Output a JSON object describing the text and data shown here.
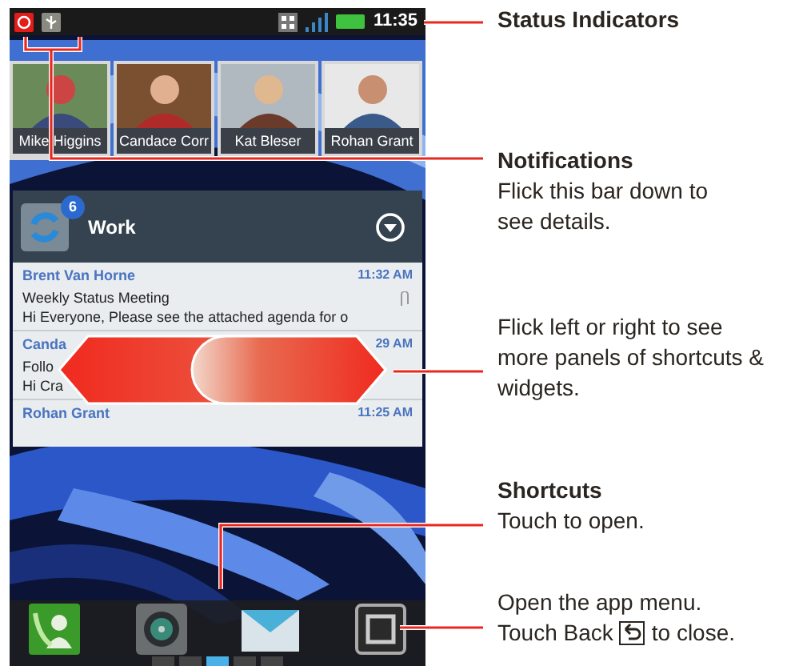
{
  "status_bar": {
    "notification_icons": [
      {
        "kind": "email"
      },
      {
        "kind": "usb"
      }
    ],
    "time": "11:35"
  },
  "contacts": [
    {
      "name": "Mike Higgins"
    },
    {
      "name": "Candace Corr"
    },
    {
      "name": "Kat Bleser"
    },
    {
      "name": "Rohan Grant"
    }
  ],
  "widget": {
    "title": "Work",
    "badge": "6",
    "messages": [
      {
        "sender": "Brent Van Horne",
        "time": "11:32 AM",
        "subject": "Weekly Status Meeting",
        "preview": "Hi Everyone, Please see the attached agenda for o",
        "attachment": true
      },
      {
        "sender": "Canda",
        "time": "29 AM",
        "subject": "Follo",
        "preview": "Hi Cra",
        "attachment": false
      },
      {
        "sender": "Rohan Grant",
        "time": "11:25 AM",
        "attachment": false
      }
    ]
  },
  "dock": [
    {
      "kind": "phone"
    },
    {
      "kind": "camera"
    },
    {
      "kind": "mail"
    },
    {
      "kind": "apps"
    }
  ],
  "pages": [
    {
      "selected": false
    },
    {
      "selected": false
    },
    {
      "selected": true
    },
    {
      "selected": false
    },
    {
      "selected": false
    }
  ],
  "callouts": [
    {
      "title": "Status Indicators"
    },
    {
      "title": "Notifications",
      "text": "Flick this bar down to see details."
    },
    {
      "text": "Flick left or right to see more panels of shortcuts & widgets."
    },
    {
      "title": "Shortcuts",
      "text": "Touch to open."
    },
    {
      "text": "Open the app menu.",
      "text_before_key": "Touch Back",
      "text_after_key": "to close."
    }
  ]
}
